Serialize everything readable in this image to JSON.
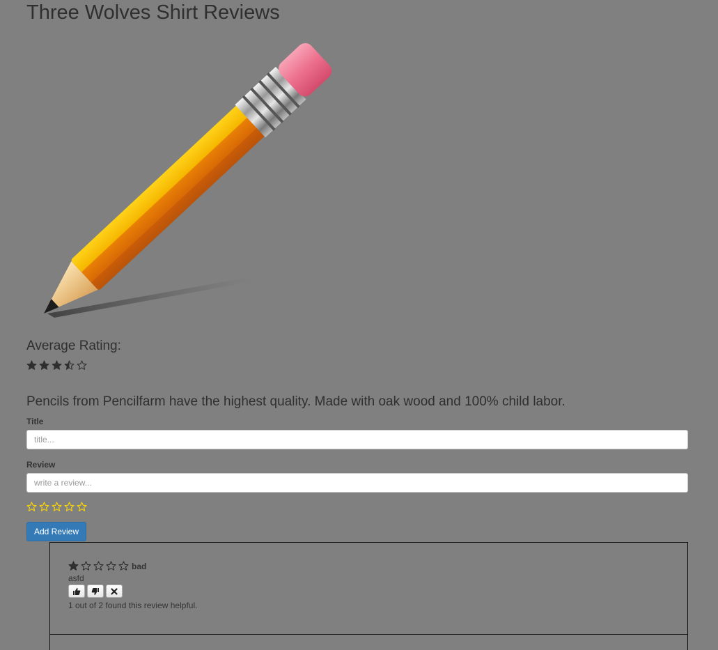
{
  "page": {
    "title": "Three Wolves Shirt Reviews",
    "average_label": "Average Rating:",
    "average_rating": 3.5,
    "description": "Pencils from Pencilfarm have the highest quality. Made with oak wood and 100% child labor."
  },
  "form": {
    "title_label": "Title",
    "title_placeholder": "title...",
    "title_value": "",
    "review_label": "Review",
    "review_placeholder": "write a review...",
    "review_value": "",
    "new_rating": 0,
    "submit_label": "Add Review"
  },
  "reviews": [
    {
      "rating": 1,
      "title": "bad",
      "body": "asfd",
      "helpful_text": "1 out of 2 found this review helpful."
    }
  ],
  "colors": {
    "background": "#808080",
    "primary": "#337ab7",
    "star_dark": "#2f2f2f",
    "star_gold": "#ffd700"
  },
  "icons": {
    "product_image": "pencil-icon",
    "rating_star": "star-icon",
    "upvote": "thumbs-up-icon",
    "downvote": "thumbs-down-icon",
    "remove": "close-icon"
  }
}
